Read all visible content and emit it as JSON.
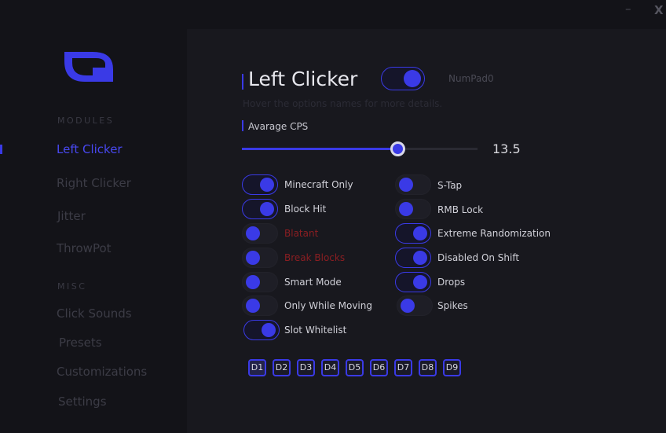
{
  "window": {
    "minimize_glyph": "–",
    "close_glyph": "X"
  },
  "sidebar": {
    "modules_label": "MODULES",
    "misc_label": "MISC",
    "modules": [
      {
        "label": "Left Clicker",
        "active": true
      },
      {
        "label": "Right Clicker",
        "active": false
      },
      {
        "label": "Jitter",
        "active": false
      },
      {
        "label": "ThrowPot",
        "active": false
      }
    ],
    "misc": [
      {
        "label": "Click Sounds"
      },
      {
        "label": "Presets"
      },
      {
        "label": "Customizations"
      },
      {
        "label": "Settings"
      }
    ]
  },
  "module": {
    "title": "Left Clicker",
    "enabled": true,
    "keybind": "NumPad0",
    "hint": "Hover the options names for more details.",
    "cps": {
      "label": "Avarage CPS",
      "value": "13.5",
      "fill_fraction": 0.66
    }
  },
  "options_left": [
    {
      "label": "Minecraft Only",
      "on": true,
      "blatant": false
    },
    {
      "label": "Block Hit",
      "on": true,
      "blatant": false
    },
    {
      "label": "Blatant",
      "on": false,
      "blatant": true
    },
    {
      "label": "Break Blocks",
      "on": false,
      "blatant": true
    },
    {
      "label": "Smart Mode",
      "on": false,
      "blatant": false
    },
    {
      "label": "Only While Moving",
      "on": false,
      "blatant": false
    },
    {
      "label": "Slot Whitelist",
      "on": true,
      "blatant": false
    }
  ],
  "options_right": [
    {
      "label": "S-Tap",
      "on": false
    },
    {
      "label": "RMB Lock",
      "on": false
    },
    {
      "label": "Extreme Randomization",
      "on": true
    },
    {
      "label": "Disabled On Shift",
      "on": true
    },
    {
      "label": "Drops",
      "on": true
    },
    {
      "label": "Spikes",
      "on": false
    }
  ],
  "slots": [
    "D1",
    "D2",
    "D3",
    "D4",
    "D5",
    "D6",
    "D7",
    "D8",
    "D9"
  ],
  "colors": {
    "accent": "#3a3ae6",
    "background": "#131318",
    "panel": "#18181e",
    "blatant": "#8a1e22"
  }
}
